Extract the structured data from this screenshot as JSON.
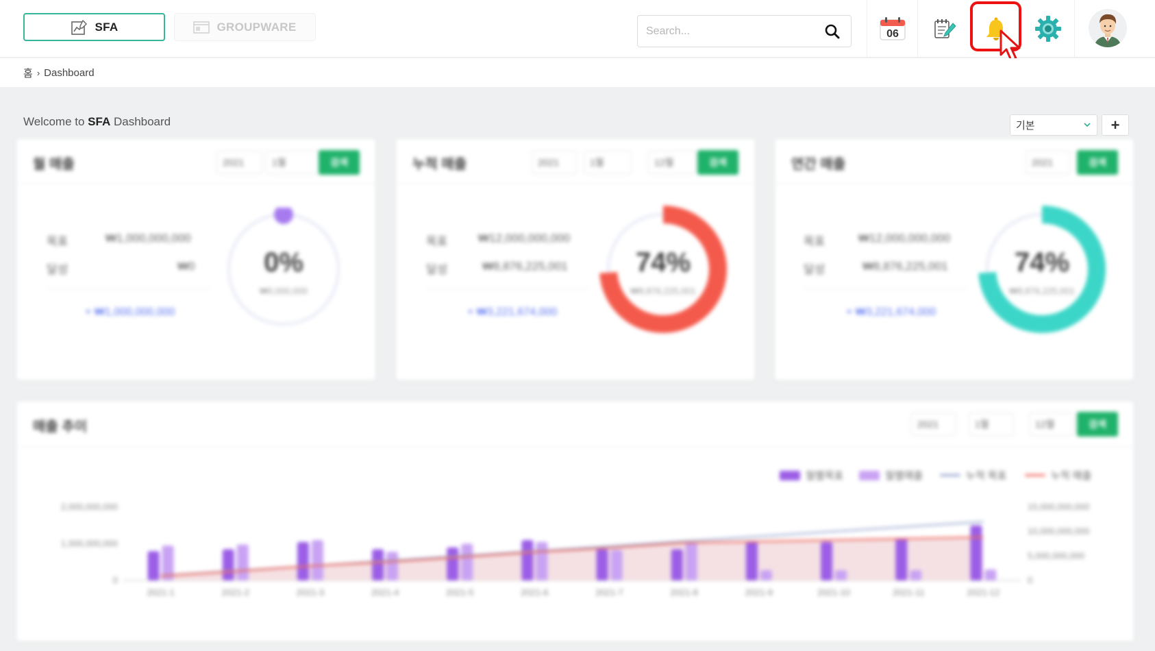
{
  "header": {
    "tabs": [
      {
        "label": "SFA",
        "active": true
      },
      {
        "label": "GROUPWARE",
        "active": false
      }
    ],
    "search": {
      "placeholder": "Search...",
      "value": ""
    },
    "calendar_day": "06",
    "icons": [
      "calendar-icon",
      "memo-icon",
      "bell-icon",
      "gear-icon",
      "avatar"
    ],
    "highlight_color": "#ee1111",
    "accent_color": "#33b69a"
  },
  "breadcrumb": {
    "home": "홈",
    "current": "Dashboard"
  },
  "welcome": {
    "prefix": "Welcome to ",
    "bold": "SFA",
    "suffix": " Dashboard"
  },
  "toolbar": {
    "preset_value": "기본",
    "add_label": "+"
  },
  "cards": [
    {
      "title": "월 매출",
      "year": "2021",
      "month_from": "1월",
      "go_label": "검색",
      "row1_label": "목표",
      "row1_value": "₩1,000,000,000",
      "row2_label": "달성",
      "row2_value": "₩0",
      "diff_value": "+ ₩1,000,000,000",
      "percent": 0,
      "percent_label": "0%",
      "amount_label": "₩0,000,000",
      "ring_color": "#a77bf0",
      "track_color": "#e8ebf7"
    },
    {
      "title": "누적 매출",
      "year": "2021",
      "month_from": "1월",
      "month_to": "12월",
      "go_label": "검색",
      "row1_label": "목표",
      "row1_value": "₩12,000,000,000",
      "row2_label": "달성",
      "row2_value": "₩8,876,225,001",
      "diff_value": "+ ₩3,221,674,000",
      "percent": 74,
      "percent_label": "74%",
      "amount_label": "₩8,876,225,001",
      "ring_color": "#f45a4c",
      "track_color": "#e8ebf7"
    },
    {
      "title": "연간 매출",
      "year": "2021",
      "go_label": "검색",
      "row1_label": "목표",
      "row1_value": "₩12,000,000,000",
      "row2_label": "달성",
      "row2_value": "₩8,876,225,001",
      "diff_value": "+ ₩3,221,674,000",
      "percent": 74,
      "percent_label": "74%",
      "amount_label": "₩8,876,225,001",
      "ring_color": "#3cd6c8",
      "track_color": "#e8ebf7"
    }
  ],
  "chart_panel": {
    "title": "매출 추이",
    "year": "2021",
    "month_from": "1월",
    "month_to": "12월",
    "go_label": "검색"
  },
  "chart_data": {
    "type": "bar",
    "categories": [
      "2021-1",
      "2021-2",
      "2021-3",
      "2021-4",
      "2021-5",
      "2021-6",
      "2021-7",
      "2021-8",
      "2021-9",
      "2021-10",
      "2021-11",
      "2021-12"
    ],
    "series": [
      {
        "name": "월별목표",
        "type": "bar",
        "axis": "left",
        "color": "#9b5ee6",
        "values": [
          800000000,
          850000000,
          1050000000,
          850000000,
          900000000,
          1100000000,
          850000000,
          850000000,
          1050000000,
          1050000000,
          1150000000,
          1500000000
        ]
      },
      {
        "name": "월별매출",
        "type": "bar",
        "axis": "left",
        "color": "#c9a3f3",
        "values": [
          950000000,
          980000000,
          1100000000,
          780000000,
          1000000000,
          1050000000,
          830000000,
          1050000000,
          280000000,
          280000000,
          280000000,
          300000000
        ]
      },
      {
        "name": "누적 목표",
        "type": "line",
        "axis": "right",
        "color": "#8fa0cc",
        "values": [
          1000000000,
          2000000000,
          3000000000,
          4000000000,
          5000000000,
          6000000000,
          7000000000,
          8000000000,
          9000000000,
          10000000000,
          11000000000,
          12000000000
        ]
      },
      {
        "name": "누적 매출",
        "type": "area",
        "axis": "right",
        "color": "#ef6b5f",
        "values": [
          900000000,
          1850000000,
          2950000000,
          3750000000,
          4750000000,
          5800000000,
          6650000000,
          7700000000,
          7950000000,
          8250000000,
          8550000000,
          8850000000
        ]
      }
    ],
    "y_left": {
      "ticks": [
        "0",
        "1,000,000,000",
        "2,000,000,000"
      ],
      "range": [
        0,
        2000000000
      ]
    },
    "y_right": {
      "ticks": [
        "0",
        "5,000,000,000",
        "10,000,000,000",
        "15,000,000,000"
      ],
      "range": [
        0,
        15000000000
      ]
    },
    "legend_position": "top-right",
    "grid": false
  }
}
